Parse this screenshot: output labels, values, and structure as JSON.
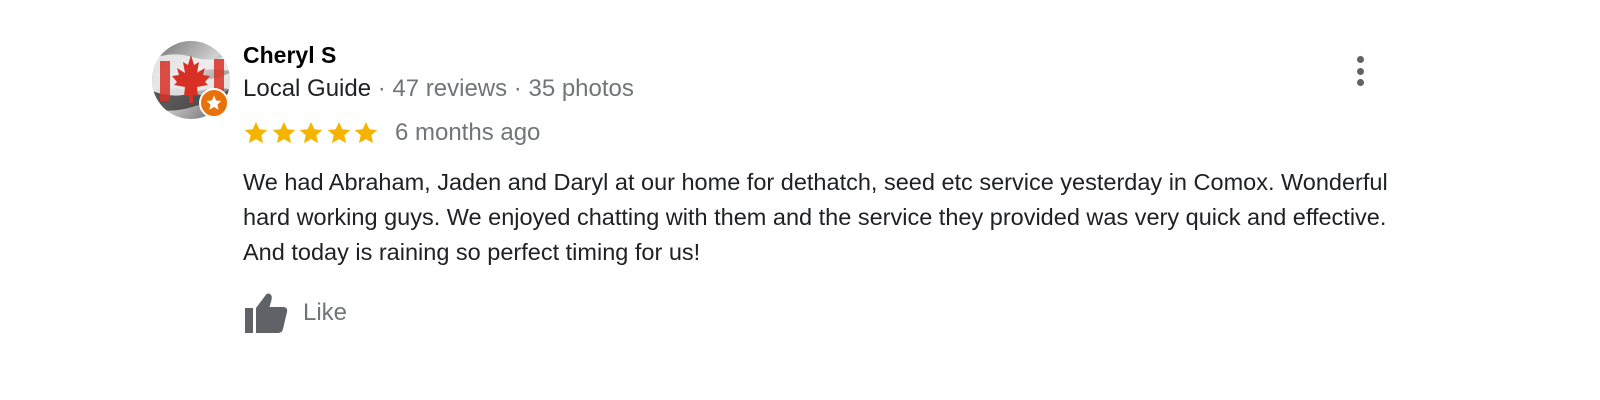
{
  "review": {
    "reviewer_name": "Cheryl S",
    "reviewer_badge": "Local Guide",
    "reviewer_stats": "· 47 reviews · 35 photos",
    "rating": 5,
    "rating_max": 5,
    "time_ago": "6 months ago",
    "text": "We had Abraham, Jaden and Daryl at our home for dethatch, seed etc service yesterday in Comox. Wonderful hard working guys. We enjoyed chatting with them and the service they provided was very quick and effective. And today is raining so perfect timing for us!",
    "like_label": "Like"
  },
  "icons": {
    "avatar": "canadian-flag-avatar",
    "badge": "local-guide-star-badge",
    "star": "star-icon",
    "like": "thumbs-up-icon",
    "more": "more-vertical-icon"
  },
  "colors": {
    "star": "#f4b400",
    "badge": "#e8710a",
    "secondary_text": "#70757a",
    "primary_text": "#202124",
    "flag_red": "#d93025"
  }
}
